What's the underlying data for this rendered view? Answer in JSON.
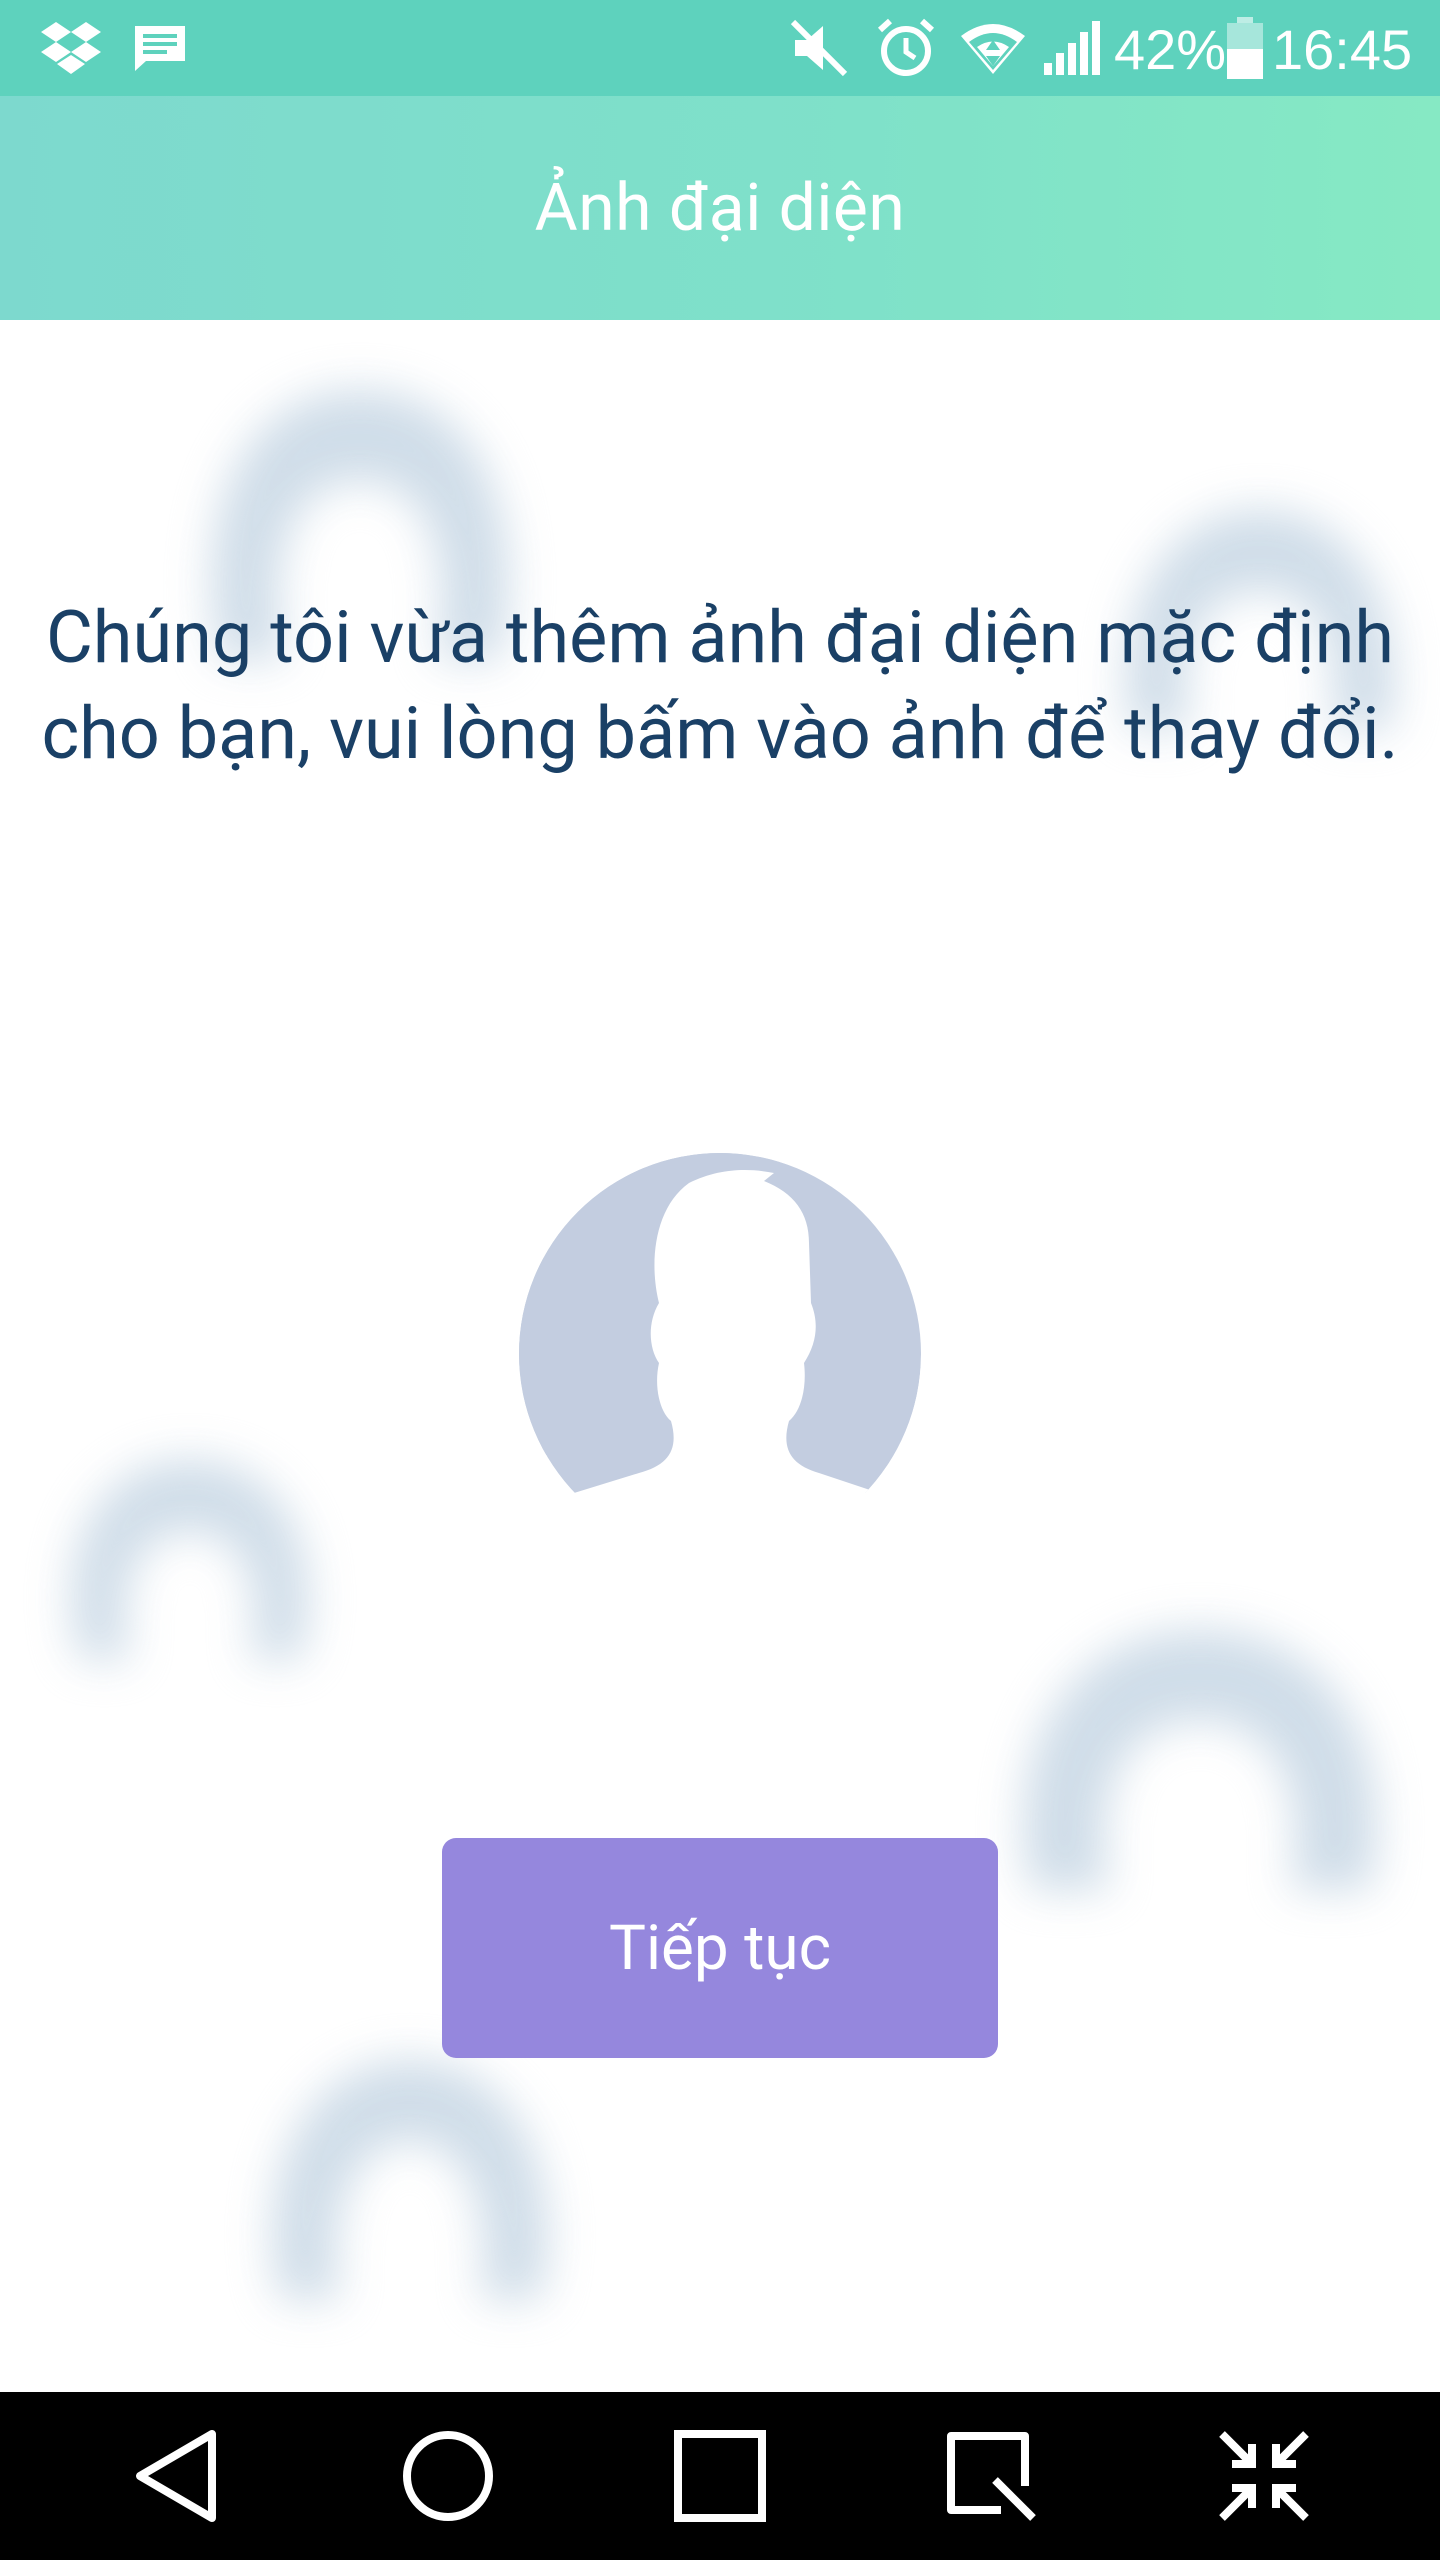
{
  "status_bar": {
    "battery_text": "42%",
    "time": "16:45",
    "icons": [
      "dropbox-icon",
      "message-icon",
      "mute-icon",
      "alarm-icon",
      "wifi-icon",
      "signal-icon",
      "battery-icon"
    ]
  },
  "app_bar": {
    "title": "Ảnh đại diện"
  },
  "main": {
    "message": "Chúng tôi vừa thêm ảnh đại diện mặc định cho bạn, vui lòng bấm vào ảnh để thay đổi.",
    "continue_label": "Tiếp tục"
  },
  "nav_bar": {
    "buttons": [
      "back-icon",
      "home-icon",
      "recents-icon",
      "capture-icon",
      "minimize-icon"
    ]
  },
  "colors": {
    "status_bar": "#5ed2bd",
    "app_bar_start": "#7dd9ce",
    "app_bar_end": "#86e9c4",
    "message_text": "#1a4066",
    "button": "#9587dd",
    "avatar_bg": "#c3cde0",
    "ghost": "#cad9e6"
  }
}
